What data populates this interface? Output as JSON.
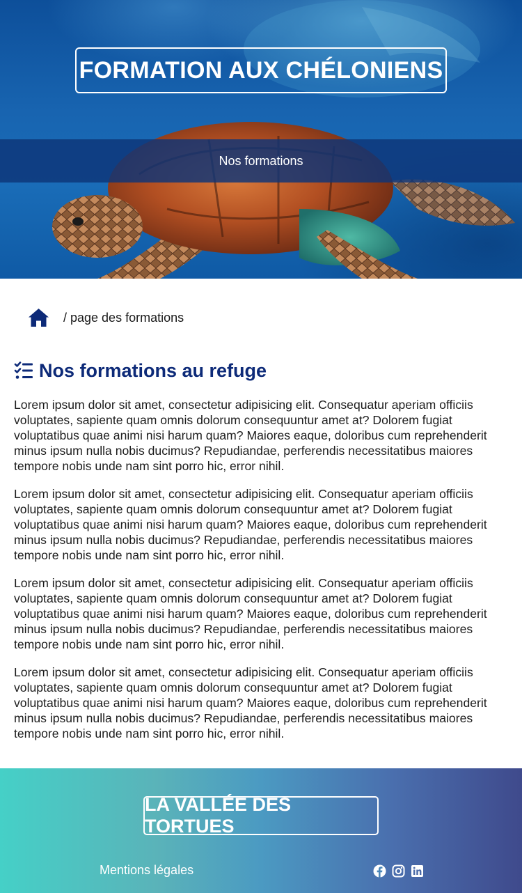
{
  "hero": {
    "title": "FORMATION AUX CHÉLONIENS",
    "nav_link": "Nos formations"
  },
  "breadcrumb": {
    "home_icon": "home-icon",
    "current": "/ page des formations"
  },
  "main": {
    "title_icon": "checklist-icon",
    "title": "Nos formations au refuge",
    "paragraphs": [
      "Lorem ipsum dolor sit amet, consectetur adipisicing elit. Consequatur aperiam officiis voluptates, sapiente quam omnis dolorum consequuntur amet at? Dolorem fugiat voluptatibus quae animi nisi harum quam? Maiores eaque, doloribus cum reprehenderit minus ipsum nulla nobis ducimus? Repudiandae, perferendis necessitatibus maiores tempore nobis unde nam sint porro hic, error nihil.",
      "Lorem ipsum dolor sit amet, consectetur adipisicing elit. Consequatur aperiam officiis voluptates, sapiente quam omnis dolorum consequuntur amet at? Dolorem fugiat voluptatibus quae animi nisi harum quam? Maiores eaque, doloribus cum reprehenderit minus ipsum nulla nobis ducimus? Repudiandae, perferendis necessitatibus maiores tempore nobis unde nam sint porro hic, error nihil.",
      "Lorem ipsum dolor sit amet, consectetur adipisicing elit. Consequatur aperiam officiis voluptates, sapiente quam omnis dolorum consequuntur amet at? Dolorem fugiat voluptatibus quae animi nisi harum quam? Maiores eaque, doloribus cum reprehenderit minus ipsum nulla nobis ducimus? Repudiandae, perferendis necessitatibus maiores tempore nobis unde nam sint porro hic, error nihil.",
      "Lorem ipsum dolor sit amet, consectetur adipisicing elit. Consequatur aperiam officiis voluptates, sapiente quam omnis dolorum consequuntur amet at? Dolorem fugiat voluptatibus quae animi nisi harum quam? Maiores eaque, doloribus cum reprehenderit minus ipsum nulla nobis ducimus? Repudiandae, perferendis necessitatibus maiores tempore nobis unde nam sint porro hic, error nihil."
    ]
  },
  "footer": {
    "brand": "LA VALLÉE DES TORTUES",
    "legal_link": "Mentions légales",
    "socials": [
      "facebook-icon",
      "instagram-icon",
      "linkedin-icon"
    ]
  },
  "colors": {
    "title_blue": "#0d2a78",
    "band_blue": "#0e3478",
    "footer_start": "#45d0c7",
    "footer_end": "#3f4a8c"
  }
}
